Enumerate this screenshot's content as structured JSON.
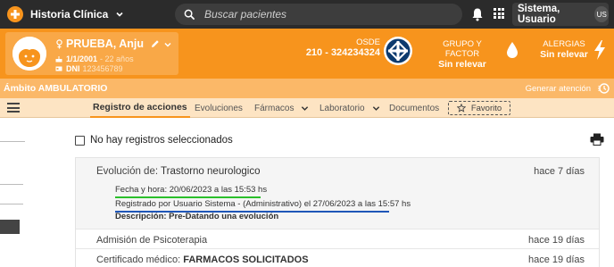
{
  "topbar": {
    "app_name": "Historia Clínica",
    "search_placeholder": "Buscar pacientes",
    "user_name": "Sistema, Usuario",
    "user_initials": "US"
  },
  "patient": {
    "name": "PRUEBA, Anju",
    "dob": "1/1/2001",
    "age": "- 22 años",
    "dni_label": "DNI",
    "dni": "123456789",
    "insurer_name": "OSDE",
    "insurer_number": "210 - 324234324",
    "blood_label": "GRUPO Y FACTOR",
    "blood_value": "Sin relevar",
    "allergy_label": "ALERGIAS",
    "allergy_value": "Sin relevar"
  },
  "ambito": {
    "label": "Ámbito AMBULATORIO",
    "generate_attention": "Generar atención"
  },
  "tabs": [
    {
      "label": "Registro de acciones"
    },
    {
      "label": "Evoluciones"
    },
    {
      "label": "Fármacos"
    },
    {
      "label": "Laboratorio"
    },
    {
      "label": "Documentos"
    },
    {
      "label": "Favorito"
    }
  ],
  "content": {
    "selection_label": "No hay registros seleccionados",
    "entries": [
      {
        "prefix": "Evolución de:",
        "title": "Trastorno neurologico",
        "time": "hace 7 días",
        "date_line": "Fecha y hora: 20/06/2023 a las 15:53 hs",
        "registered_line": "Registrado por Usuario Sistema - (Administrativo) el 27/06/2023 a las 15:57 hs",
        "description_line": "Descripción: Pre-Datando una evolución"
      },
      {
        "prefix": "Admisión de Psicoterapia",
        "title": "",
        "time": "hace 19 días"
      },
      {
        "prefix": "Certificado médico:",
        "title": "FARMACOS SOLICITADOS",
        "time": "hace 19 días"
      }
    ]
  },
  "colors": {
    "topbar": "#2b2b2b",
    "orange": "#f7941d",
    "ambito": "#fbb868",
    "tabbar": "#fde4c3",
    "green_underline": "#2bbf2b",
    "blue_underline": "#1f56b8"
  }
}
